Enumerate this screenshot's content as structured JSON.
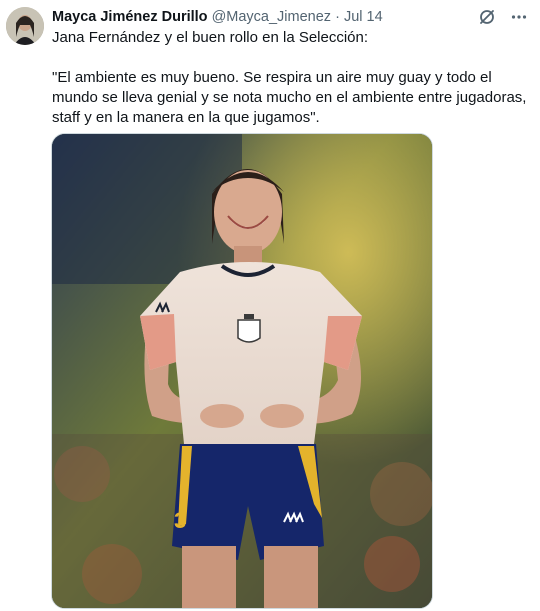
{
  "tweet": {
    "author_name": "Mayca Jiménez Durillo",
    "handle": "@Mayca_Jimenez",
    "separator": "·",
    "date": "Jul 14",
    "line1": "Jana Fernández y el buen rollo en la Selección:",
    "quote": "\"El ambiente es muy bueno. Se respira un aire muy guay y todo el mundo se lleva genial y se nota mucho en el ambiente entre jugadoras, staff y en la manera en la que jugamos\".",
    "icons": {
      "grok": "slashed-circle-icon",
      "more": "more-dots-icon"
    },
    "jersey_number": "3"
  }
}
